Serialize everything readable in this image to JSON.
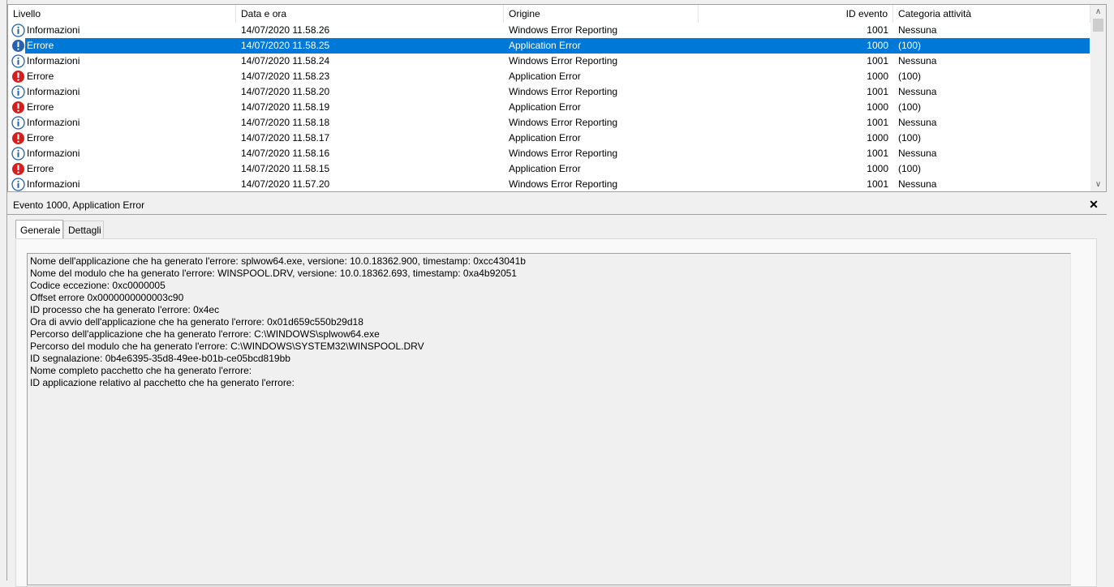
{
  "columns": [
    "Livello",
    "Data e ora",
    "Origine",
    "ID evento",
    "Categoria attività"
  ],
  "rows": [
    {
      "level": "Informazioni",
      "icon": "info-icon",
      "datetime": "14/07/2020 11.58.26",
      "source": "Windows Error Reporting",
      "event_id": "1001",
      "category": "Nessuna",
      "selected": false
    },
    {
      "level": "Errore",
      "icon": "error-icon",
      "datetime": "14/07/2020 11.58.25",
      "source": "Application Error",
      "event_id": "1000",
      "category": "(100)",
      "selected": true
    },
    {
      "level": "Informazioni",
      "icon": "info-icon",
      "datetime": "14/07/2020 11.58.24",
      "source": "Windows Error Reporting",
      "event_id": "1001",
      "category": "Nessuna",
      "selected": false
    },
    {
      "level": "Errore",
      "icon": "error-icon",
      "datetime": "14/07/2020 11.58.23",
      "source": "Application Error",
      "event_id": "1000",
      "category": "(100)",
      "selected": false
    },
    {
      "level": "Informazioni",
      "icon": "info-icon",
      "datetime": "14/07/2020 11.58.20",
      "source": "Windows Error Reporting",
      "event_id": "1001",
      "category": "Nessuna",
      "selected": false
    },
    {
      "level": "Errore",
      "icon": "error-icon",
      "datetime": "14/07/2020 11.58.19",
      "source": "Application Error",
      "event_id": "1000",
      "category": "(100)",
      "selected": false
    },
    {
      "level": "Informazioni",
      "icon": "info-icon",
      "datetime": "14/07/2020 11.58.18",
      "source": "Windows Error Reporting",
      "event_id": "1001",
      "category": "Nessuna",
      "selected": false
    },
    {
      "level": "Errore",
      "icon": "error-icon",
      "datetime": "14/07/2020 11.58.17",
      "source": "Application Error",
      "event_id": "1000",
      "category": "(100)",
      "selected": false
    },
    {
      "level": "Informazioni",
      "icon": "info-icon",
      "datetime": "14/07/2020 11.58.16",
      "source": "Windows Error Reporting",
      "event_id": "1001",
      "category": "Nessuna",
      "selected": false
    },
    {
      "level": "Errore",
      "icon": "error-icon",
      "datetime": "14/07/2020 11.58.15",
      "source": "Application Error",
      "event_id": "1000",
      "category": "(100)",
      "selected": false
    },
    {
      "level": "Informazioni",
      "icon": "info-icon",
      "datetime": "14/07/2020 11.57.20",
      "source": "Windows Error Reporting",
      "event_id": "1001",
      "category": "Nessuna",
      "selected": false
    }
  ],
  "detail": {
    "title": "Evento 1000, Application Error",
    "close_icon": "close-icon",
    "tabs": [
      "Generale",
      "Dettagli"
    ],
    "active_tab": "Generale",
    "description_lines": [
      "Nome dell'applicazione che ha generato l'errore: splwow64.exe, versione: 10.0.18362.900, timestamp: 0xcc43041b",
      "Nome del modulo che ha generato l'errore: WINSPOOL.DRV, versione: 10.0.18362.693, timestamp: 0xa4b92051",
      "Codice eccezione: 0xc0000005",
      "Offset errore 0x0000000000003c90",
      "ID processo che ha generato l'errore: 0x4ec",
      "Ora di avvio dell'applicazione che ha generato l'errore: 0x01d659c550b29d18",
      "Percorso dell'applicazione che ha generato l'errore: C:\\WINDOWS\\splwow64.exe",
      "Percorso del modulo che ha generato l'errore: C:\\WINDOWS\\SYSTEM32\\WINSPOOL.DRV",
      "ID segnalazione: 0b4e6395-35d8-49ee-b01b-ce05bcd819bb",
      "Nome completo pacchetto che ha generato l'errore:",
      "ID applicazione relativo al pacchetto che ha generato l'errore:"
    ]
  },
  "colors": {
    "selection": "#0078d7",
    "info_icon": "#1f5fa8",
    "error_icon": "#d21f1f"
  }
}
